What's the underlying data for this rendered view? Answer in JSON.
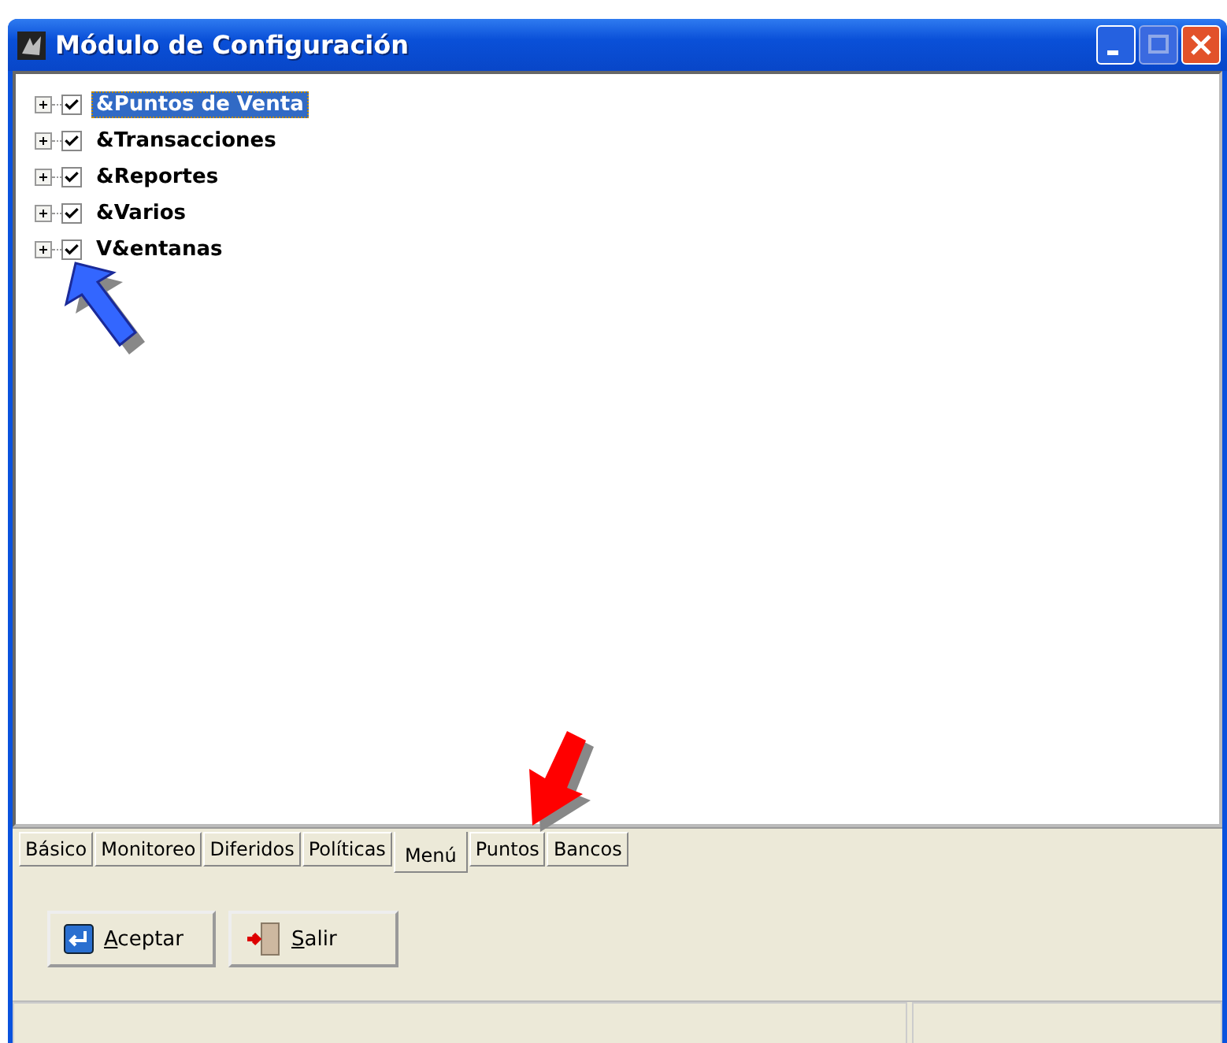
{
  "window": {
    "title": "Módulo de Configuración"
  },
  "tree": [
    {
      "label": "&Puntos de Venta",
      "checked": true,
      "selected": true,
      "expanded": false
    },
    {
      "label": "&Transacciones",
      "checked": true,
      "selected": false,
      "expanded": false
    },
    {
      "label": "&Reportes",
      "checked": true,
      "selected": false,
      "expanded": false
    },
    {
      "label": "&Varios",
      "checked": true,
      "selected": false,
      "expanded": false
    },
    {
      "label": "V&entanas",
      "checked": true,
      "selected": false,
      "expanded": false
    }
  ],
  "tabs": [
    {
      "label": "Básico",
      "selected": false
    },
    {
      "label": "Monitoreo",
      "selected": false
    },
    {
      "label": "Diferidos",
      "selected": false
    },
    {
      "label": "Políticas",
      "selected": false
    },
    {
      "label": "Menú",
      "selected": true
    },
    {
      "label": "Puntos",
      "selected": false
    },
    {
      "label": "Bancos",
      "selected": false
    }
  ],
  "buttons": [
    {
      "label": "Aceptar",
      "kind": "accept"
    },
    {
      "label": "Salir",
      "kind": "exit"
    }
  ]
}
